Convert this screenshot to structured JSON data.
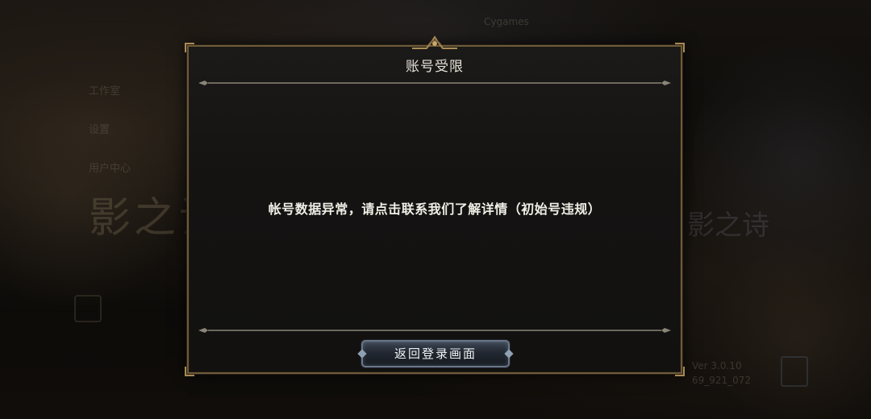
{
  "background": {
    "menu_items": [
      "工作室",
      "设置",
      "用户中心"
    ],
    "brand": "Cygames",
    "title_left": "影之诗",
    "title_right": "影之诗",
    "version": "Ver 3.0.10",
    "build": "69_921_072"
  },
  "dialog": {
    "title": "账号受限",
    "message": "帐号数据异常，请点击联系我们了解详情（初始号违规）",
    "return_button_label": "返回登录画面"
  },
  "colors": {
    "frame_gold": "#6e5a3a",
    "panel_bg": "#141312",
    "text": "#f1eee6",
    "button_border": "#6a7688"
  }
}
